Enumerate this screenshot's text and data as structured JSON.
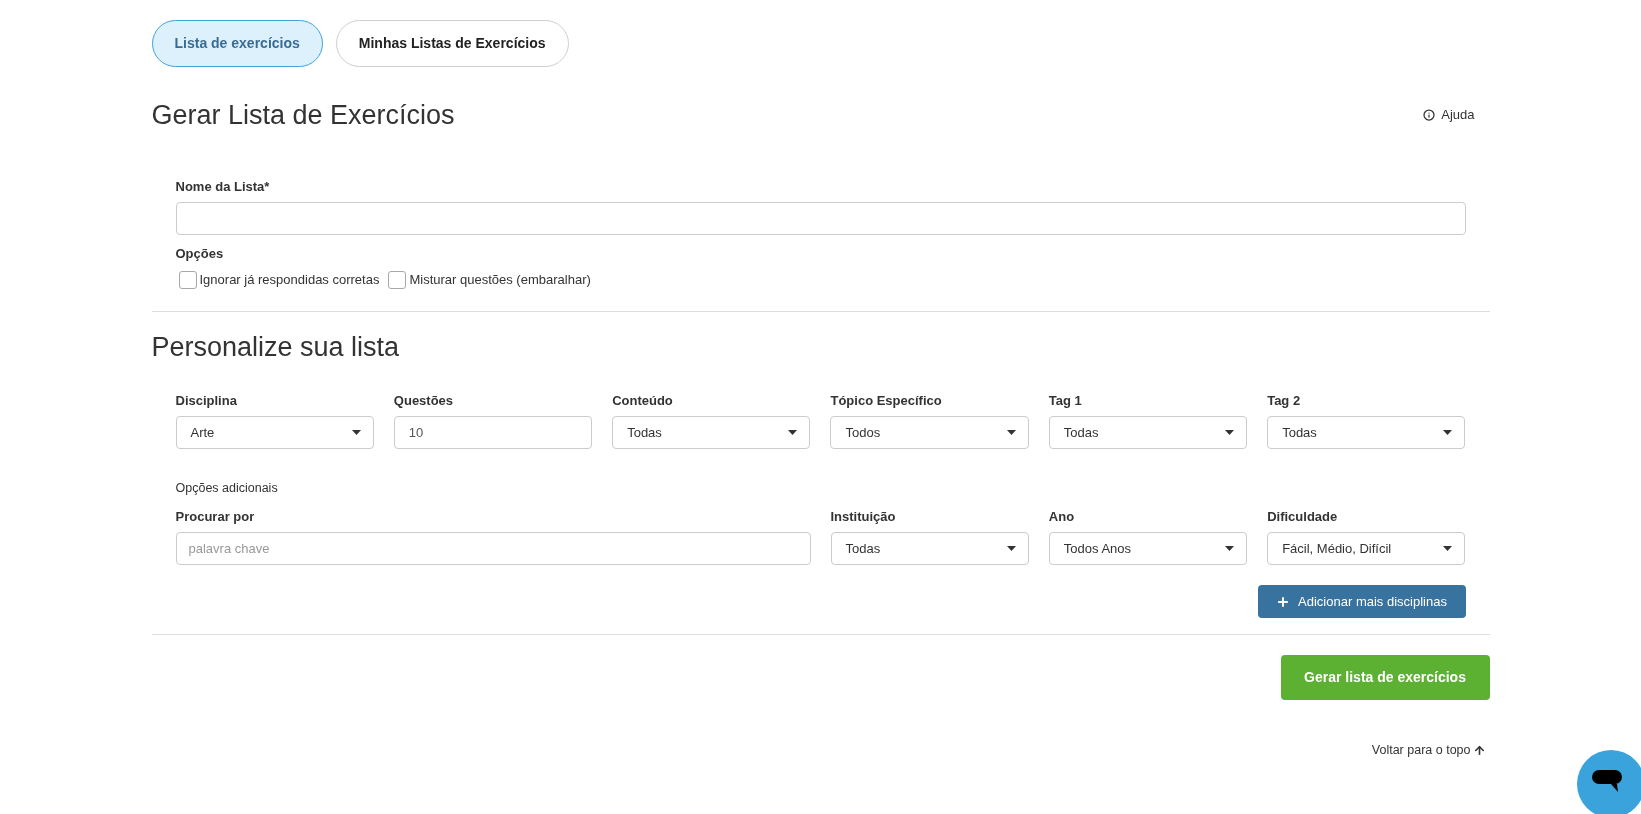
{
  "tabs": [
    {
      "label": "Lista de exercícios",
      "selected": true
    },
    {
      "label": "Minhas Listas de Exercícios",
      "selected": false
    }
  ],
  "header": {
    "title": "Gerar Lista de Exercícios",
    "help_link": "Ajuda"
  },
  "list_form": {
    "name_label": "Nome da Lista*",
    "options_label": "Opções",
    "options": [
      {
        "label": "Ignorar já respondidas corretas",
        "checked": false
      },
      {
        "label": "Misturar questões (embaralhar)",
        "checked": false
      }
    ]
  },
  "customize": {
    "title": "Personalize sua lista",
    "filters": [
      {
        "kind": "select",
        "label": "Disciplina",
        "value": "Arte"
      },
      {
        "kind": "number",
        "label": "Questões",
        "value": "10"
      },
      {
        "kind": "select",
        "label": "Conteúdo",
        "value": "Todas"
      },
      {
        "kind": "select",
        "label": "Tópico Específico",
        "value": "Todos"
      },
      {
        "kind": "select",
        "label": "Tag 1",
        "value": "Todas"
      },
      {
        "kind": "select",
        "label": "Tag 2",
        "value": "Todas"
      }
    ],
    "additional_label": "Opções adicionais",
    "additional_filters": [
      {
        "kind": "search",
        "label": "Procurar por",
        "placeholder": "palavra chave"
      },
      {
        "kind": "select",
        "label": "Instituição",
        "value": "Todas"
      },
      {
        "kind": "select",
        "label": "Ano",
        "value": "Todos Anos"
      },
      {
        "kind": "select",
        "label": "Dificuldade",
        "value": "Fácil, Médio, Difícil"
      }
    ],
    "add_button": "Adicionar mais disciplinas"
  },
  "submit_button": "Gerar lista de exercícios",
  "back_to_top": "Voltar para o topo"
}
